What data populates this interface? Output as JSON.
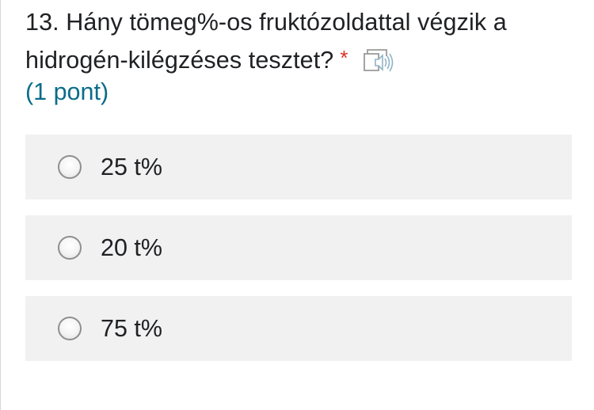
{
  "question": {
    "line1": "13. Hány tömeg%-os fruktózoldattal végzik a",
    "line2": "hidrogén-kilégzéses tesztet?",
    "required_marker": "*",
    "points": "(1 pont)",
    "read_aloud_icon": "speaker-book-icon"
  },
  "options": [
    {
      "label": "25 t%",
      "selected": false
    },
    {
      "label": "20 t%",
      "selected": false
    },
    {
      "label": "75 t%",
      "selected": false
    }
  ],
  "colors": {
    "text": "#202124",
    "points": "#0b6c8a",
    "required": "#d93025",
    "option_bg": "#f1f1f1",
    "radio_border": "#8f8f8f"
  }
}
